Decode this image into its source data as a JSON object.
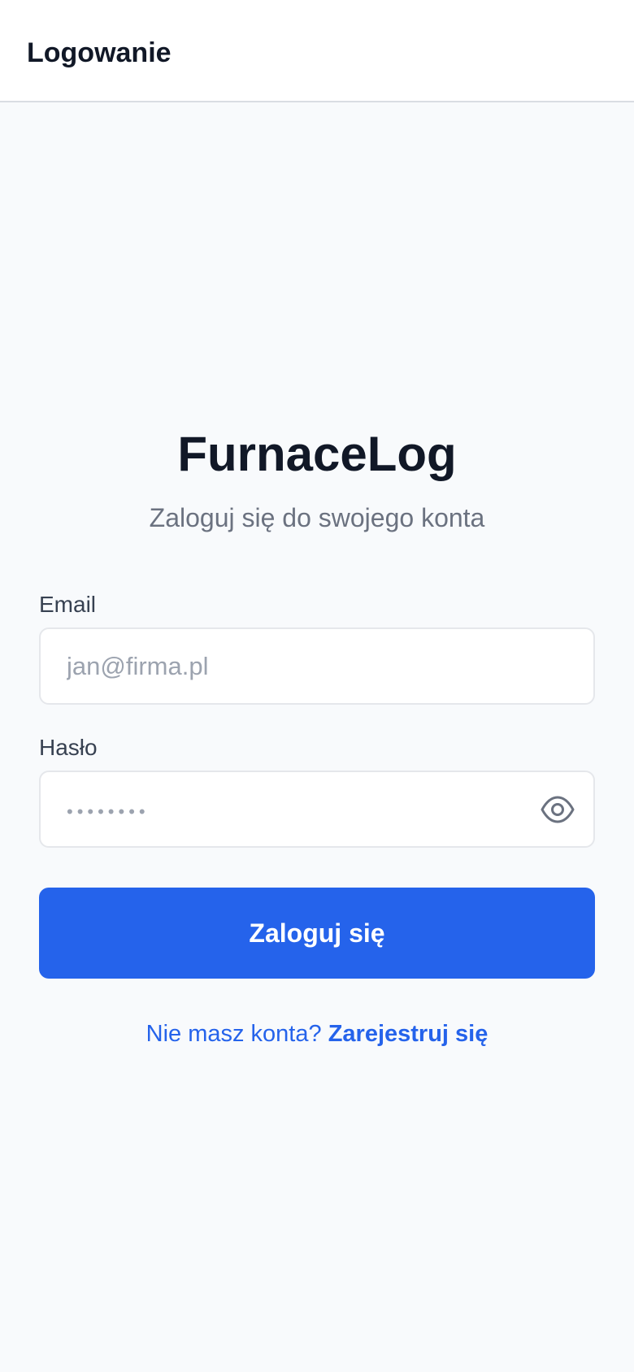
{
  "header": {
    "title": "Logowanie"
  },
  "brand": {
    "name": "FurnaceLog",
    "subtitle": "Zaloguj się do swojego konta"
  },
  "form": {
    "email": {
      "label": "Email",
      "value": "",
      "placeholder": "jan@firma.pl"
    },
    "password": {
      "label": "Hasło",
      "value": "",
      "placeholder": "••••••••",
      "toggle_icon": "eye-icon"
    },
    "submit_label": "Zaloguj się"
  },
  "footer": {
    "prompt": "Nie masz konta?",
    "register_label": "Zarejestruj się"
  },
  "colors": {
    "accent": "#2563eb",
    "background": "#f8fafc",
    "header_background": "#ffffff",
    "text_primary": "#111827",
    "text_muted": "#6b7280"
  }
}
